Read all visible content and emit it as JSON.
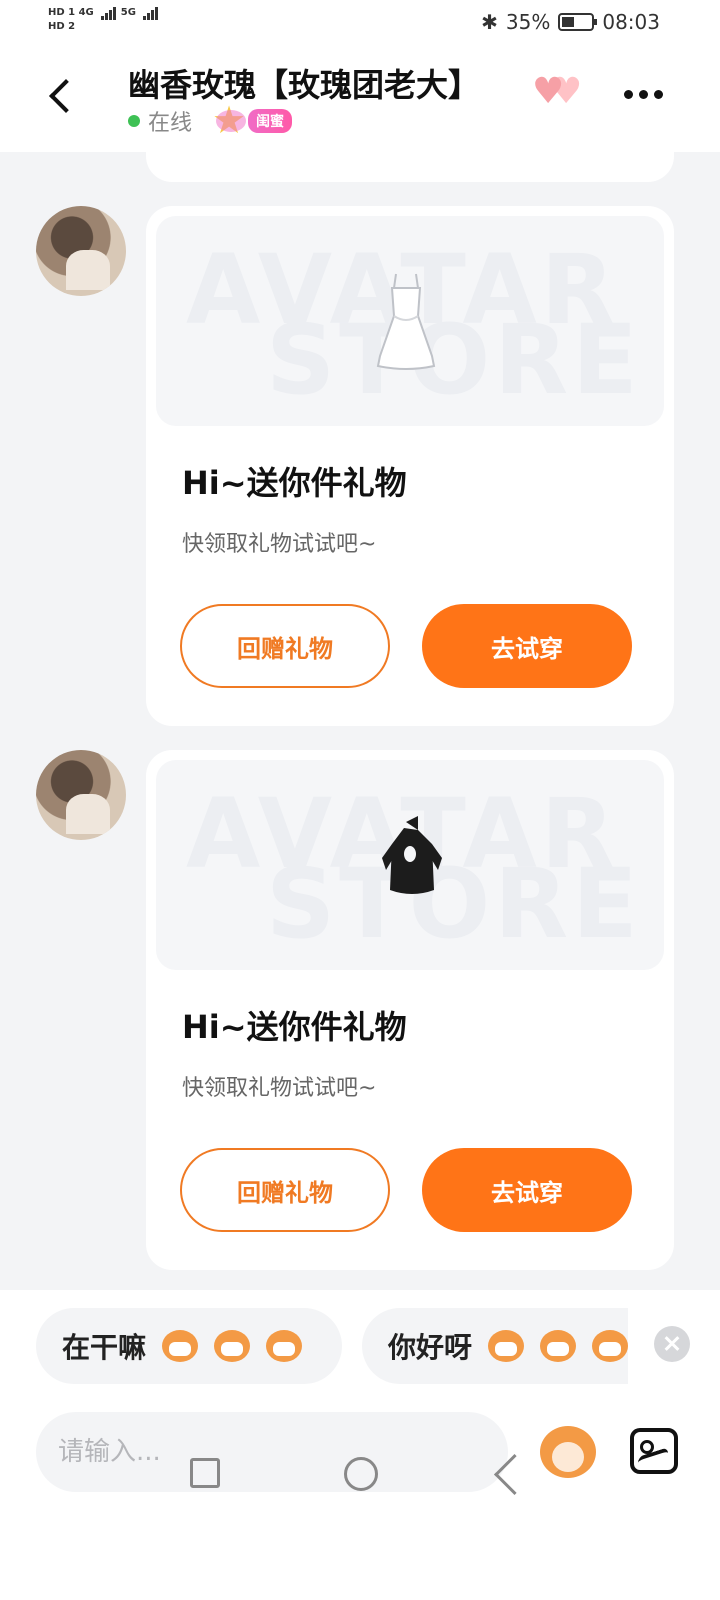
{
  "status_bar": {
    "hd1": "HD 1",
    "hd2": "HD 2",
    "net1": "4G",
    "net2": "5G",
    "battery": "35%",
    "time": "08:03"
  },
  "header": {
    "title": "幽香玫瑰【玫瑰团老大】",
    "online_label": "在线",
    "relation_badge": "闺蜜"
  },
  "messages": [
    {
      "gift_title": "Hi~送你件礼物",
      "gift_subtitle": "快领取礼物试试吧~",
      "watermark_line1": "AVATAR",
      "watermark_line2": "STORE",
      "item": "white-dress-icon",
      "return_label": "回赠礼物",
      "try_label": "去试穿"
    },
    {
      "gift_title": "Hi~送你件礼物",
      "gift_subtitle": "快领取礼物试试吧~",
      "watermark_line1": "AVATAR",
      "watermark_line2": "STORE",
      "item": "black-halter-top-icon",
      "return_label": "回赠礼物",
      "try_label": "去试穿"
    }
  ],
  "quick_replies": [
    {
      "text": "在干嘛"
    },
    {
      "text": "你好呀"
    }
  ],
  "composer": {
    "placeholder": "请输入..."
  },
  "colors": {
    "accent": "#ff7417",
    "online": "#3ec155",
    "badge": "#f06cc6"
  }
}
